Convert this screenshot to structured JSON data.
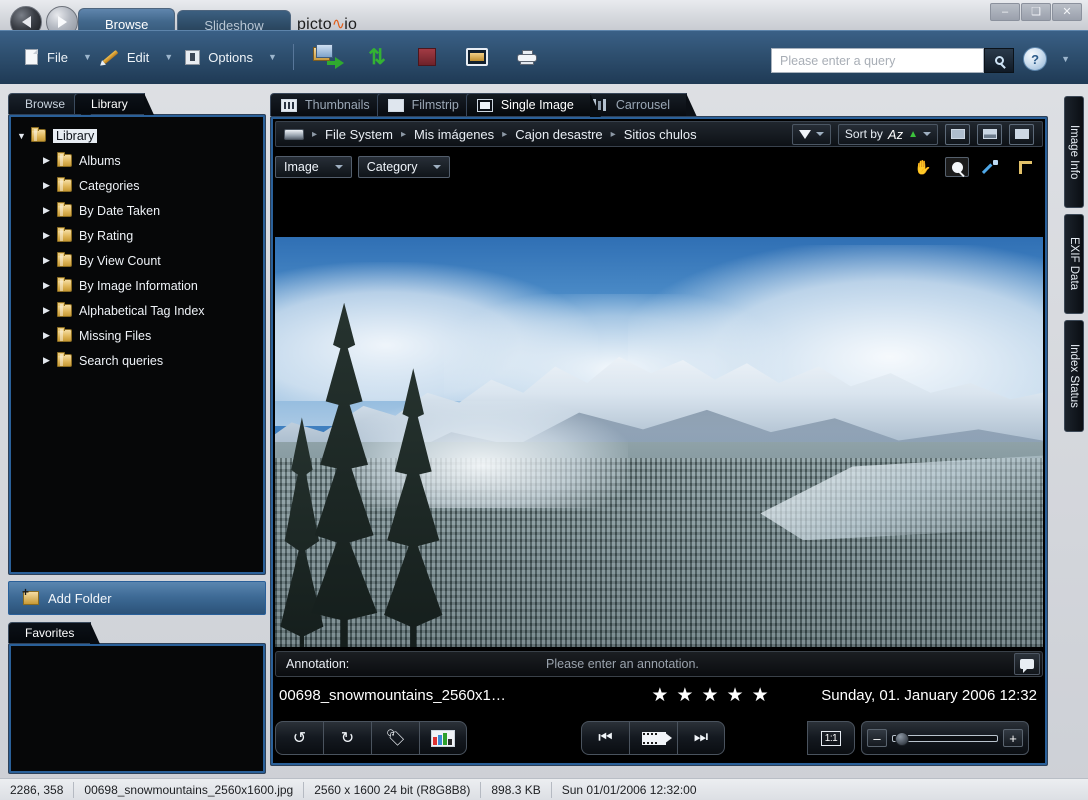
{
  "window": {
    "minimize_label": "–",
    "maximize_label": "❑",
    "close_label": "✕"
  },
  "brand": {
    "text_a": "picto",
    "wave": "∿",
    "text_b": "io"
  },
  "top_tabs": [
    {
      "label": "Browse",
      "active": true
    },
    {
      "label": "Slideshow",
      "active": false
    }
  ],
  "nav": {
    "back": "back-arrow",
    "forward": "forward-arrow"
  },
  "menu": [
    {
      "label": "File",
      "icon": "page-icon"
    },
    {
      "label": "Edit",
      "icon": "pencil-icon"
    },
    {
      "label": "Options",
      "icon": "options-icon"
    }
  ],
  "toolbar_icons": [
    {
      "name": "export-images-icon"
    },
    {
      "name": "synchronize-icon"
    },
    {
      "name": "stop-icon"
    },
    {
      "name": "fullscreen-icon"
    },
    {
      "name": "print-icon"
    }
  ],
  "search": {
    "placeholder": "Please enter a query",
    "button": "search-icon"
  },
  "help": {
    "label": "?"
  },
  "left_panel": {
    "tabs": [
      {
        "label": "Browse",
        "active": false
      },
      {
        "label": "Library",
        "active": true
      }
    ],
    "tree": [
      {
        "label": "Library",
        "level": 0,
        "expanded": true,
        "selected": true
      },
      {
        "label": "Albums",
        "level": 1,
        "expanded": false,
        "selected": false
      },
      {
        "label": "Categories",
        "level": 1,
        "expanded": false,
        "selected": false
      },
      {
        "label": "By Date Taken",
        "level": 1,
        "expanded": false,
        "selected": false
      },
      {
        "label": "By Rating",
        "level": 1,
        "expanded": false,
        "selected": false
      },
      {
        "label": "By View Count",
        "level": 1,
        "expanded": false,
        "selected": false
      },
      {
        "label": "By Image Information",
        "level": 1,
        "expanded": false,
        "selected": false
      },
      {
        "label": "Alphabetical Tag Index",
        "level": 1,
        "expanded": false,
        "selected": false
      },
      {
        "label": "Missing Files",
        "level": 1,
        "expanded": false,
        "selected": false
      },
      {
        "label": "Search queries",
        "level": 1,
        "expanded": false,
        "selected": false
      }
    ],
    "add_folder_label": "Add Folder",
    "favorites_tab": "Favorites"
  },
  "view_tabs": [
    {
      "label": "Thumbnails",
      "icon": "grid-icon",
      "active": false
    },
    {
      "label": "Filmstrip",
      "icon": "filmstrip-icon",
      "active": false
    },
    {
      "label": "Single Image",
      "icon": "single-image-icon",
      "active": true
    },
    {
      "label": "Carrousel",
      "icon": "carrousel-icon",
      "active": false
    }
  ],
  "breadcrumb": {
    "drive_icon": "drive-icon",
    "items": [
      "File System",
      "Mis imágenes",
      "Cajon desastre",
      "Sitios chulos"
    ],
    "separator": "▸",
    "filter_label": "",
    "sort_label": "Sort by",
    "sort_value": "Az",
    "layout_buttons": [
      "layout-top-icon",
      "layout-split-icon",
      "layout-full-icon"
    ]
  },
  "filter_bar": {
    "buttons": [
      "Image",
      "Category"
    ],
    "tools": [
      "hand-tool-icon",
      "zoom-tool-icon",
      "eyedropper-tool-icon",
      "crop-tool-icon"
    ],
    "active_tool": "zoom-tool-icon"
  },
  "annotation": {
    "label": "Annotation:",
    "placeholder": "Please enter an annotation.",
    "button_icon": "speech-bubble-icon"
  },
  "image_info": {
    "filename_display": "00698_snowmountains_2560x1…",
    "rating": 5,
    "rating_max": 5,
    "star_glyph": "★",
    "date": "Sunday, 01. January 2006 12:32"
  },
  "bottom_buttons": {
    "group1": [
      {
        "name": "rotate-left-button",
        "glyph": "↺"
      },
      {
        "name": "rotate-right-button",
        "glyph": "↻"
      },
      {
        "name": "tag-button",
        "glyph": ""
      },
      {
        "name": "histogram-button",
        "glyph": ""
      }
    ],
    "group2": [
      {
        "name": "first-image-button",
        "glyph": "⏮"
      },
      {
        "name": "slideshow-button",
        "glyph": ""
      },
      {
        "name": "last-image-button",
        "glyph": "⏭"
      }
    ],
    "group3": [
      {
        "name": "actual-size-button",
        "label": "1:1"
      }
    ],
    "zoom": {
      "minus": "–",
      "plus": "+",
      "value": 5
    }
  },
  "right_tabs": [
    {
      "label": "Image Info"
    },
    {
      "label": "EXIF Data"
    },
    {
      "label": "Index Status"
    }
  ],
  "status_bar": [
    "2286, 358",
    "00698_snowmountains_2560x1600.jpg",
    "2560 x 1600 24 bit (R8G8B8)",
    "898.3 KB",
    "Sun 01/01/2006 12:32:00"
  ],
  "colors": {
    "accent_blue": "#2a6099",
    "chrome_blue": "#2e4f6f",
    "panel_black": "#060708",
    "brand_orange": "#e0601d"
  }
}
